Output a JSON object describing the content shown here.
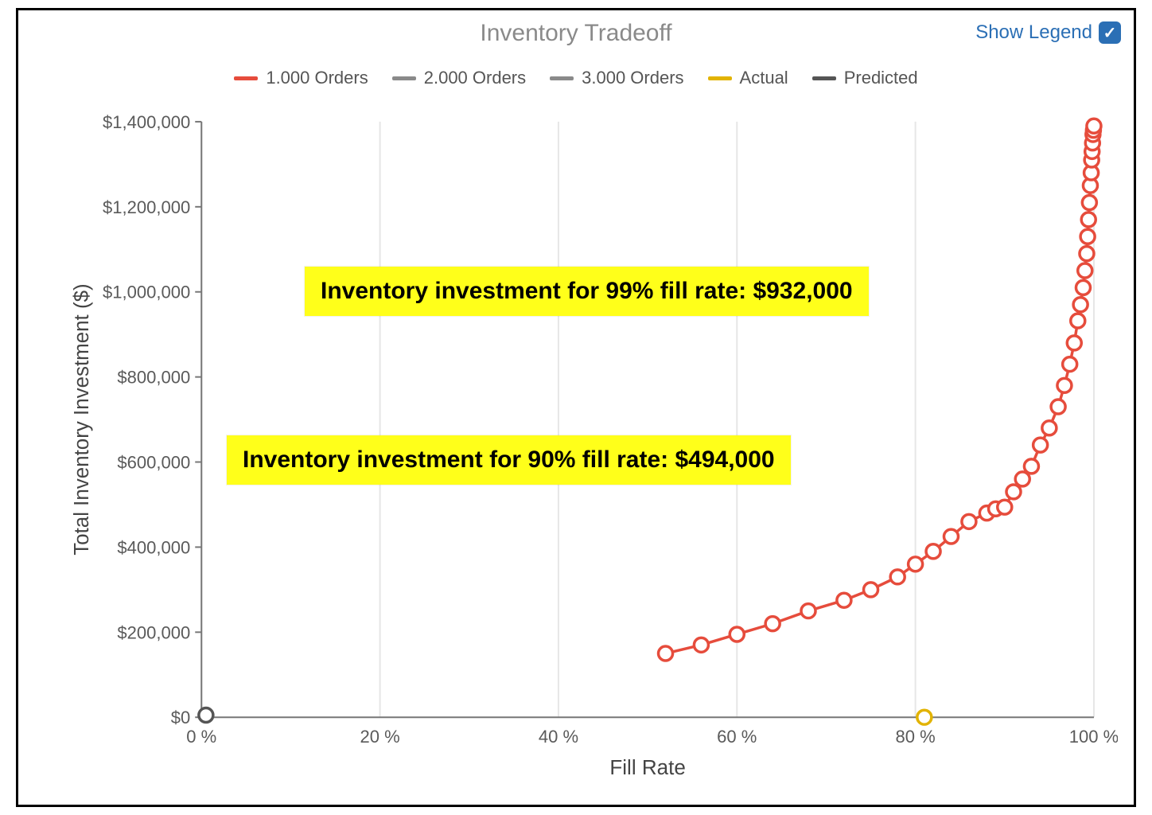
{
  "title": "Inventory Tradeoff",
  "legend_toggle": {
    "label": "Show Legend",
    "checked": true
  },
  "legend": [
    {
      "label": "1.000 Orders",
      "color": "#e64c3c"
    },
    {
      "label": "2.000 Orders",
      "color": "#8a8a8a"
    },
    {
      "label": "3.000 Orders",
      "color": "#8a8a8a"
    },
    {
      "label": "Actual",
      "color": "#e2b300"
    },
    {
      "label": "Predicted",
      "color": "#555555"
    }
  ],
  "callouts": [
    {
      "text": "Inventory investment for 99% fill rate: $932,000"
    },
    {
      "text": "Inventory investment for 90% fill rate: $494,000"
    }
  ],
  "axes": {
    "x": {
      "title": "Fill Rate",
      "min": 0,
      "max": 100,
      "ticks": [
        0,
        20,
        40,
        60,
        80,
        100
      ],
      "tick_labels": [
        "0 %",
        "20 %",
        "40 %",
        "60 %",
        "80 %",
        "100 %"
      ]
    },
    "y": {
      "title": "Total Inventory Investment ($)",
      "min": 0,
      "max": 1400000,
      "ticks": [
        0,
        200000,
        400000,
        600000,
        800000,
        1000000,
        1200000,
        1400000
      ],
      "tick_labels": [
        "$0",
        "$200,000",
        "$400,000",
        "$600,000",
        "$800,000",
        "$1,000,000",
        "$1,200,000",
        "$1,400,000"
      ]
    }
  },
  "chart_data": {
    "type": "line",
    "title": "Inventory Tradeoff",
    "xlabel": "Fill Rate",
    "ylabel": "Total Inventory Investment ($)",
    "xlim": [
      0,
      100
    ],
    "ylim": [
      0,
      1400000
    ],
    "series": [
      {
        "name": "1.000 Orders",
        "color": "#e64c3c",
        "x": [
          52,
          56,
          60,
          64,
          68,
          72,
          75,
          78,
          80,
          82,
          84,
          86,
          88,
          89,
          90,
          91,
          92,
          93,
          94,
          95,
          96,
          96.7,
          97.3,
          97.8,
          98.2,
          98.5,
          98.8,
          99.0,
          99.2,
          99.3,
          99.4,
          99.5,
          99.6,
          99.7,
          99.75,
          99.8,
          99.85,
          99.9,
          99.95,
          100
        ],
        "y": [
          150000,
          170000,
          195000,
          220000,
          250000,
          275000,
          300000,
          330000,
          360000,
          390000,
          425000,
          460000,
          480000,
          490000,
          494000,
          530000,
          560000,
          590000,
          640000,
          680000,
          730000,
          780000,
          830000,
          880000,
          932000,
          970000,
          1010000,
          1050000,
          1090000,
          1130000,
          1170000,
          1210000,
          1250000,
          1280000,
          1310000,
          1330000,
          1350000,
          1370000,
          1380000,
          1390000
        ]
      },
      {
        "name": "2.000 Orders",
        "color": "#8a8a8a",
        "x": [],
        "y": []
      },
      {
        "name": "3.000 Orders",
        "color": "#8a8a8a",
        "x": [],
        "y": []
      },
      {
        "name": "Actual",
        "color": "#e2b300",
        "x": [
          81
        ],
        "y": [
          0
        ]
      },
      {
        "name": "Predicted",
        "color": "#555555",
        "x": [
          0.5
        ],
        "y": [
          5000
        ]
      }
    ]
  }
}
